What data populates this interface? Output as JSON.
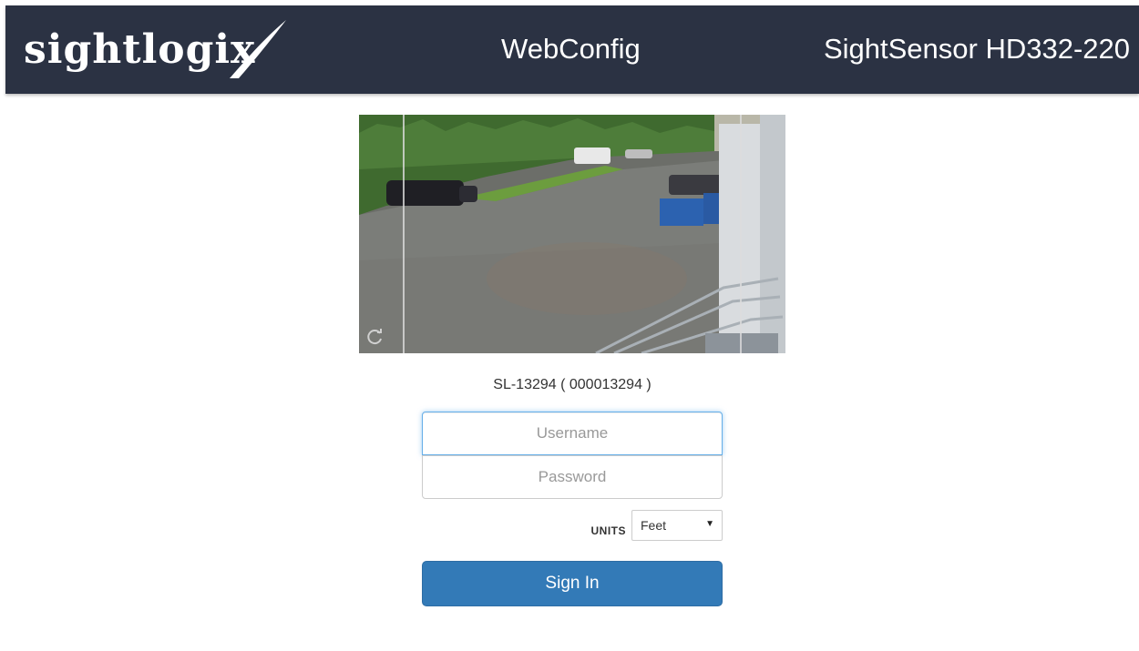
{
  "header": {
    "logo_text": "sightlogix",
    "app_name": "WebConfig",
    "model": "SightSensor HD332-220"
  },
  "camera": {
    "icons": [
      "refresh-icon"
    ]
  },
  "device": {
    "id_line": "SL-13294 ( 000013294 )"
  },
  "login": {
    "username_placeholder": "Username",
    "password_placeholder": "Password",
    "units_label": "UNITS",
    "units_value": "Feet",
    "units_caret": "▼",
    "signin_label": "Sign In"
  },
  "colors": {
    "header_bg": "#2b3243",
    "primary_button": "#337ab7",
    "focus_border": "#66afe9"
  }
}
